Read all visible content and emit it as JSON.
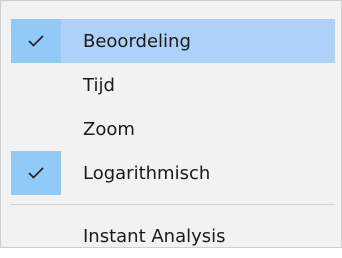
{
  "menu": {
    "items": [
      {
        "label": "Beoordeling",
        "checked": true,
        "highlighted": true,
        "check_icon": "checkmark-icon"
      },
      {
        "label": "Tijd",
        "checked": false,
        "highlighted": false
      },
      {
        "label": "Zoom",
        "checked": false,
        "highlighted": false
      },
      {
        "label": "Logarithmisch",
        "checked": true,
        "highlighted": false,
        "check_icon": "checkmark-icon"
      }
    ],
    "after_separator": [
      {
        "label": "Instant Analysis"
      }
    ]
  },
  "colors": {
    "menu_background": "#f2f2f2",
    "hover_background": "#aed1f9",
    "check_background": "#91c9f7",
    "check_mark": "#1f1f1f",
    "separator": "#d2d2d2"
  }
}
